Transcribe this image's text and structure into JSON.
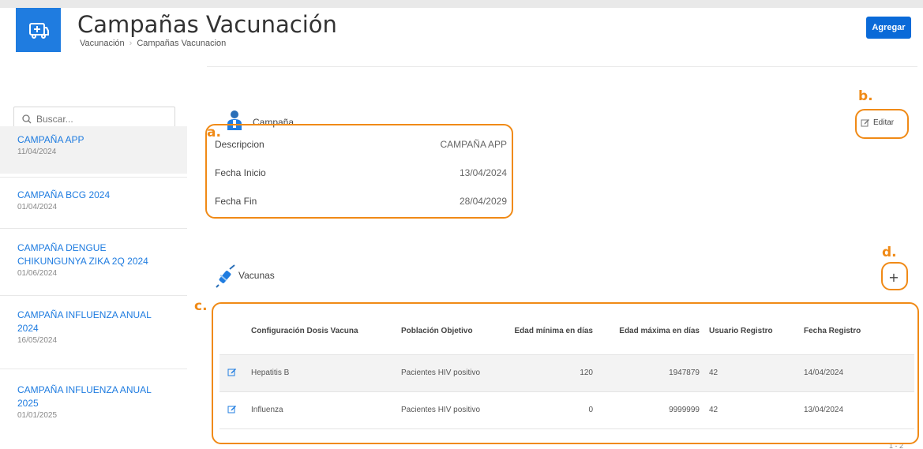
{
  "header": {
    "title": "Campañas Vacunación",
    "breadcrumb": [
      "Vacunación",
      "Campañas Vacunacion"
    ],
    "add_label": "Agregar"
  },
  "sidebar": {
    "search_placeholder": "Buscar...",
    "items": [
      {
        "name": "CAMPAÑA APP",
        "date": "11/04/2024"
      },
      {
        "name": "CAMPAÑA BCG 2024",
        "date": "01/04/2024"
      },
      {
        "name": "CAMPAÑA DENGUE CHIKUNGUNYA ZIKA 2Q 2024",
        "date": "01/06/2024"
      },
      {
        "name": "CAMPAÑA INFLUENZA ANUAL 2024",
        "date": "16/05/2024"
      },
      {
        "name": "CAMPAÑA INFLUENZA ANUAL 2025",
        "date": "01/01/2025"
      }
    ]
  },
  "campaign": {
    "section_title": "Campaña",
    "edit_label": "Editar",
    "fields": [
      {
        "label": "Descripcion",
        "value": "CAMPAÑA APP"
      },
      {
        "label": "Fecha Inicio",
        "value": "13/04/2024"
      },
      {
        "label": "Fecha Fin",
        "value": "28/04/2029"
      }
    ]
  },
  "vaccines": {
    "section_title": "Vacunas",
    "add_symbol": "+",
    "columns": [
      "Configuración Dosis Vacuna",
      "Población Objetivo",
      "Edad mínima en días",
      "Edad máxima en días",
      "Usuario Registro",
      "Fecha Registro"
    ],
    "rows": [
      {
        "dose": "Hepatitis B",
        "population": "Pacientes HIV positivo",
        "min_age": "120",
        "max_age": "1947879",
        "user": "42",
        "date": "14/04/2024"
      },
      {
        "dose": "Influenza",
        "population": "Pacientes HIV positivo",
        "min_age": "0",
        "max_age": "9999999",
        "user": "42",
        "date": "13/04/2024"
      }
    ],
    "pagination": "1 - 2"
  },
  "annotations": {
    "a": "a.",
    "b": "b.",
    "c": "c.",
    "d": "d."
  },
  "colors": {
    "primary": "#1f7ce0",
    "button": "#0a6ad8",
    "annotation": "#f08a16"
  }
}
